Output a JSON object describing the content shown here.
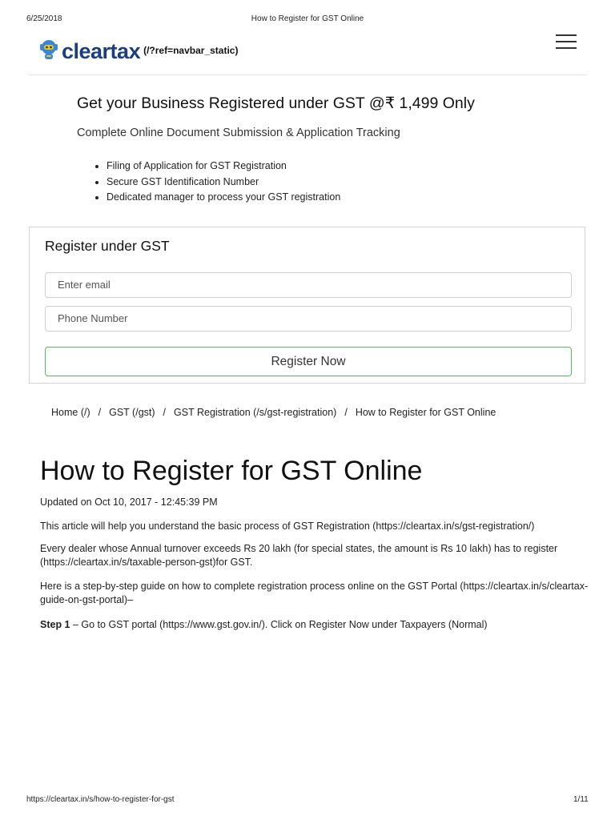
{
  "print_header": {
    "date": "6/25/2018",
    "title": "How to Register for GST Online"
  },
  "navbar": {
    "logo_text": "cleartax",
    "logo_link": "(/?ref=navbar_static)",
    "colors": {
      "logo_text": "#1b3f7a",
      "mascot_body": "#3b86d6",
      "mascot_accent": "#f5c518"
    }
  },
  "promo": {
    "title": "Get your Business Registered under GST @₹ 1,499 Only",
    "subtitle": "Complete Online Document Submission & Application Tracking",
    "bullets": [
      "Filing of Application for GST Registration",
      "Secure GST Identification Number",
      "Dedicated manager to process your GST registration"
    ]
  },
  "form": {
    "title": "Register under GST",
    "email_placeholder": "Enter email",
    "phone_placeholder": "Phone Number",
    "submit_label": "Register Now",
    "colors": {
      "button_border": "#5cb85c"
    }
  },
  "breadcrumb": {
    "items": [
      "Home (/)",
      "GST (/gst)",
      "GST Registration (/s/gst-registration)",
      "How to Register for GST Online"
    ],
    "separator": "/"
  },
  "article": {
    "title": "How to Register for GST Online",
    "updated": "Updated on Oct 10, 2017 - 12:45:39 PM",
    "p1": "This article will help you understand the basic process of GST Registration (https://cleartax.in/s/gst-registration/)",
    "p2": "Every dealer whose Annual turnover exceeds Rs 20 lakh (for special states, the amount is Rs 10 lakh) has to register (https://cleartax.in/s/taxable-person-gst)for GST.",
    "p3": "Here is a step-by-step guide on how to complete registration process online on the GST Portal (https://cleartax.in/s/cleartax-guide-on-gst-portal)–",
    "step1_label": "Step 1",
    "step1_text": " – Go to GST portal (https://www.gst.gov.in/). Click on Register Now under Taxpayers (Normal)"
  },
  "print_footer": {
    "url": "https://cleartax.in/s/how-to-register-for-gst",
    "page": "1/11"
  }
}
